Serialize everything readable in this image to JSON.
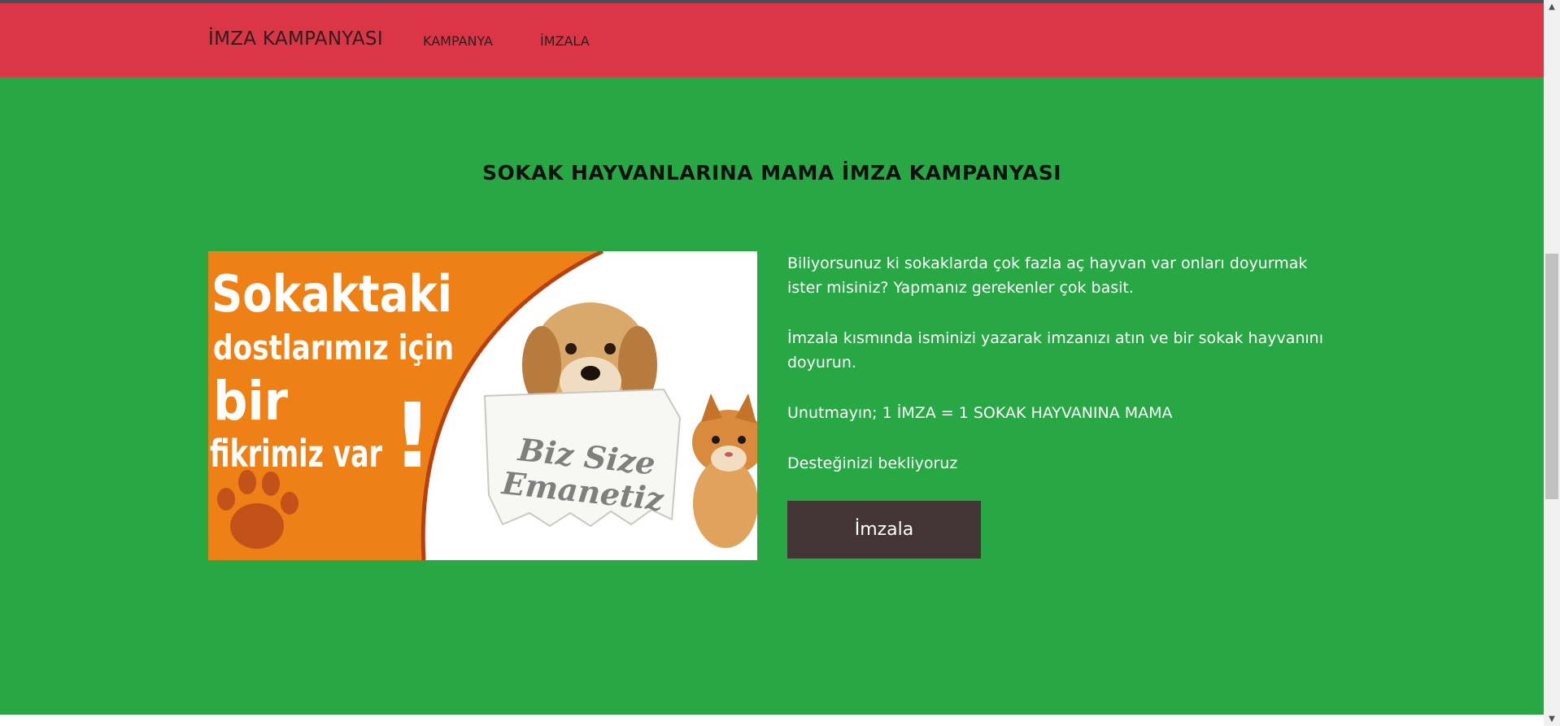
{
  "navbar": {
    "brand": "İMZA KAMPANYASI",
    "links": [
      {
        "label": "KAMPANYA"
      },
      {
        "label": "İMZALA"
      }
    ]
  },
  "campaign": {
    "title": "SOKAK HAYVANLARINA MAMA İMZA KAMPANYASI",
    "image": {
      "line1": "Sokaktaki",
      "line2": "dostlarımız için",
      "line3": "bir",
      "line4": "fikrimiz var",
      "exclaim": "!",
      "note_line1": "Biz Size",
      "note_line2": "Emanetiz"
    },
    "paragraphs": [
      "Biliyorsunuz ki sokaklarda çok fazla aç hayvan var onları doyurmak ister misiniz? Yapmanız gerekenler çok basit.",
      "İmzala kısmında isminizi yazarak imzanızı atın ve bir sokak hayvanını doyurun.",
      "Unutmayın; 1 İMZA = 1 SOKAK HAYVANINA MAMA",
      "Desteğinizi bekliyoruz"
    ],
    "button_label": "İmzala"
  },
  "colors": {
    "navbar_bg": "#dc3545",
    "main_bg": "#28a745",
    "button_bg": "#433535",
    "promo_orange": "#ee8016"
  },
  "scrollbar": {
    "up_icon": "triangle-up-icon",
    "down_icon": "triangle-down-icon"
  }
}
